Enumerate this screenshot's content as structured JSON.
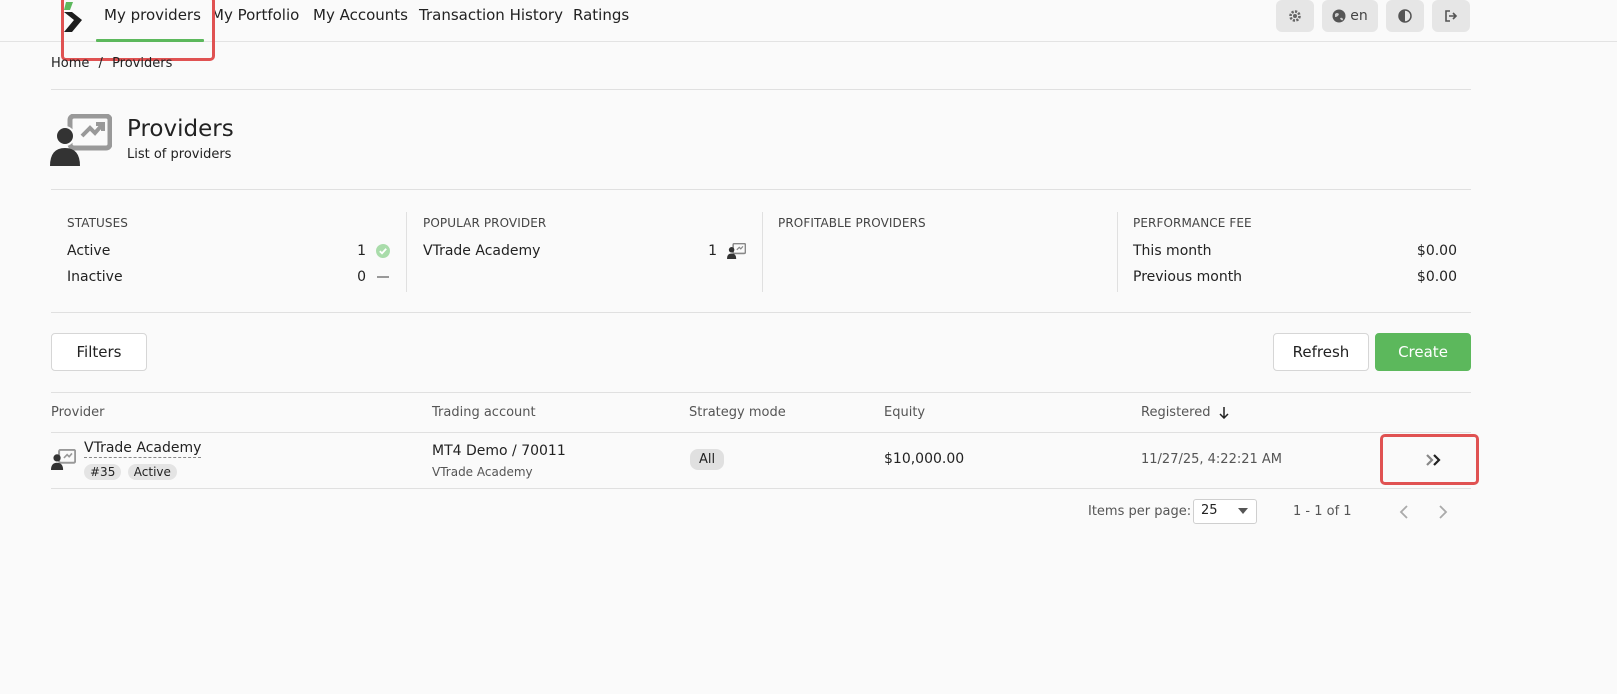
{
  "nav": {
    "items": [
      "My providers",
      "My Portfolio",
      "My Accounts",
      "Transaction History",
      "Ratings"
    ],
    "active_index": 0,
    "language": "en",
    "accent_color": "#5cb85c"
  },
  "breadcrumb": {
    "home": "Home",
    "separator": "/",
    "current": "Providers"
  },
  "header": {
    "title": "Providers",
    "subtitle": "List of providers",
    "icon": "provider-icon"
  },
  "stats": {
    "statuses": {
      "heading": "STATUSES",
      "rows": [
        {
          "label": "Active",
          "value": "1",
          "icon": "check-circle-icon"
        },
        {
          "label": "Inactive",
          "value": "0",
          "icon": "dash-icon"
        }
      ]
    },
    "popular": {
      "heading": "POPULAR PROVIDER",
      "rows": [
        {
          "label": "VTrade Academy",
          "value": "1",
          "icon": "provider-icon"
        }
      ]
    },
    "profitable": {
      "heading": "PROFITABLE PROVIDERS"
    },
    "fee": {
      "heading": "PERFORMANCE FEE",
      "rows": [
        {
          "label": "This month",
          "value": "$0.00"
        },
        {
          "label": "Previous month",
          "value": "$0.00"
        }
      ]
    }
  },
  "toolbar": {
    "filters": "Filters",
    "refresh": "Refresh",
    "create": "Create"
  },
  "table": {
    "headers": [
      "Provider",
      "Trading account",
      "Strategy mode",
      "Equity",
      "Registered"
    ],
    "sort_icon": "arrow-down-icon",
    "rows": [
      {
        "provider": "VTrade Academy",
        "id": "#35",
        "status": "Active",
        "account": "MT4 Demo / 70011",
        "account_sub": "VTrade Academy",
        "mode": "All",
        "equity": "$10,000.00",
        "registered": "11/27/25, 4:22:21 AM",
        "action_icon": "double-chevron-right-icon"
      }
    ]
  },
  "pagination": {
    "items_label": "Items per page:",
    "per_page": "25",
    "range": "1 - 1 of 1"
  }
}
